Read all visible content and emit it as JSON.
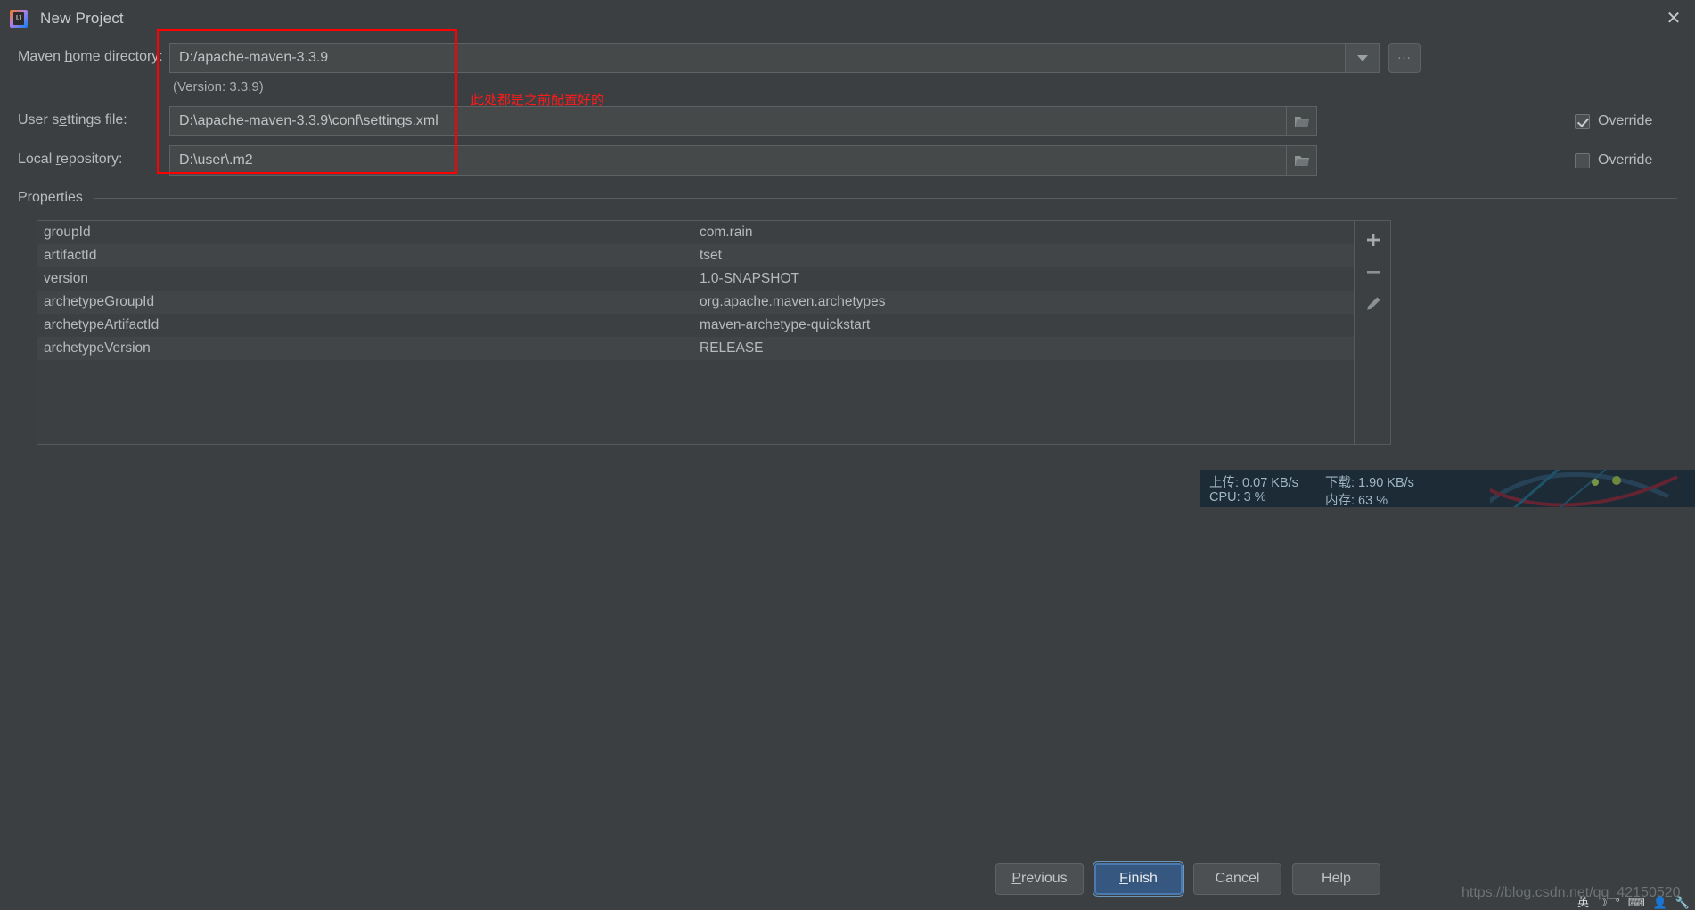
{
  "window": {
    "title": "New Project",
    "app_icon": "intellij-idea-icon",
    "close_icon": "close-icon"
  },
  "form": {
    "maven_home": {
      "label": "Maven home directory:",
      "label_mnemonic": "h",
      "value": "D:/apache-maven-3.3.9",
      "dropdown_icon": "chevron-down-icon",
      "browse_label": "...",
      "version_note": "(Version: 3.3.9)"
    },
    "user_settings": {
      "label": "User settings file:",
      "label_mnemonic": "s",
      "value": "D:\\apache-maven-3.3.9\\conf\\settings.xml",
      "folder_icon": "folder-icon",
      "override_label": "Override",
      "override_checked": true
    },
    "local_repository": {
      "label": "Local repository:",
      "label_mnemonic": "r",
      "value": "D:\\user\\.m2",
      "folder_icon": "folder-icon",
      "override_label": "Override",
      "override_checked": false
    }
  },
  "annotation": {
    "text": "此处都是之前配置好的",
    "color": "#ff1a1a",
    "box_color": "#ff0000"
  },
  "properties": {
    "section_label": "Properties",
    "rows": [
      {
        "key": "groupId",
        "value": "com.rain"
      },
      {
        "key": "artifactId",
        "value": "tset"
      },
      {
        "key": "version",
        "value": "1.0-SNAPSHOT"
      },
      {
        "key": "archetypeGroupId",
        "value": "org.apache.maven.archetypes"
      },
      {
        "key": "archetypeArtifactId",
        "value": "maven-archetype-quickstart"
      },
      {
        "key": "archetypeVersion",
        "value": "RELEASE"
      }
    ],
    "toolbar": [
      {
        "name": "add-property-button",
        "icon": "plus-icon"
      },
      {
        "name": "remove-property-button",
        "icon": "minus-icon"
      },
      {
        "name": "edit-property-button",
        "icon": "pencil-icon"
      }
    ]
  },
  "net_monitor": {
    "upload_label": "上传: 0.07 KB/s",
    "download_label": "下载: 1.90 KB/s",
    "cpu_label": "CPU: 3 %",
    "memory_label": "内存: 63 %"
  },
  "footer": {
    "previous": "Previous",
    "previous_mnemonic": "P",
    "finish": "Finish",
    "finish_mnemonic": "F",
    "cancel": "Cancel",
    "help": "Help",
    "accent_color": "#365880"
  },
  "watermark": {
    "text": "https://blog.csdn.net/qq_42150520"
  },
  "tray": {
    "items": [
      {
        "name": "ime-language-icon",
        "glyph": "英"
      },
      {
        "name": "moon-icon",
        "glyph": "☽"
      },
      {
        "name": "degree-icon",
        "glyph": "°"
      },
      {
        "name": "keyboard-icon",
        "glyph": "⌨"
      },
      {
        "name": "user-icon",
        "glyph": "👤"
      },
      {
        "name": "wrench-icon",
        "glyph": "🔧"
      }
    ]
  }
}
